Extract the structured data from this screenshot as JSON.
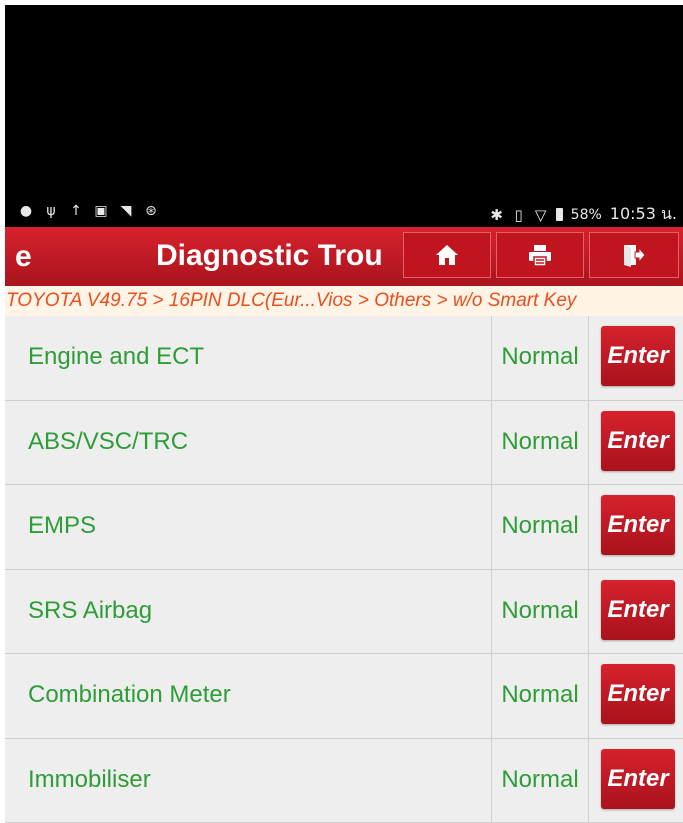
{
  "statusbar": {
    "left_icons": [
      "chat-icon",
      "usb-icon",
      "upload-icon",
      "image-icon",
      "wifi-question-icon",
      "bluetooth-circle-icon"
    ],
    "right_icons": [
      "bluetooth-icon",
      "vibrate-icon",
      "signal-icon",
      "battery-icon"
    ],
    "battery": "58%",
    "time": "10:53 น."
  },
  "header": {
    "left_stub": "e",
    "title": "Diagnostic Trou",
    "buttons": [
      "home-icon",
      "print-icon",
      "exit-icon"
    ]
  },
  "breadcrumb": "TOYOTA V49.75 > 16PIN DLC(Eur...Vios > Others > w/o Smart Key",
  "systems": [
    {
      "name": "Engine and ECT",
      "status": "Normal",
      "action": "Enter"
    },
    {
      "name": "ABS/VSC/TRC",
      "status": "Normal",
      "action": "Enter"
    },
    {
      "name": "EMPS",
      "status": "Normal",
      "action": "Enter"
    },
    {
      "name": "SRS Airbag",
      "status": "Normal",
      "action": "Enter"
    },
    {
      "name": "Combination Meter",
      "status": "Normal",
      "action": "Enter"
    },
    {
      "name": "Immobiliser",
      "status": "Normal",
      "action": "Enter"
    }
  ],
  "colors": {
    "header": "#c0151f",
    "breadcrumb_text": "#ea4e1c",
    "row_text": "#2e9d38",
    "row_bg": "#eeeeee"
  }
}
